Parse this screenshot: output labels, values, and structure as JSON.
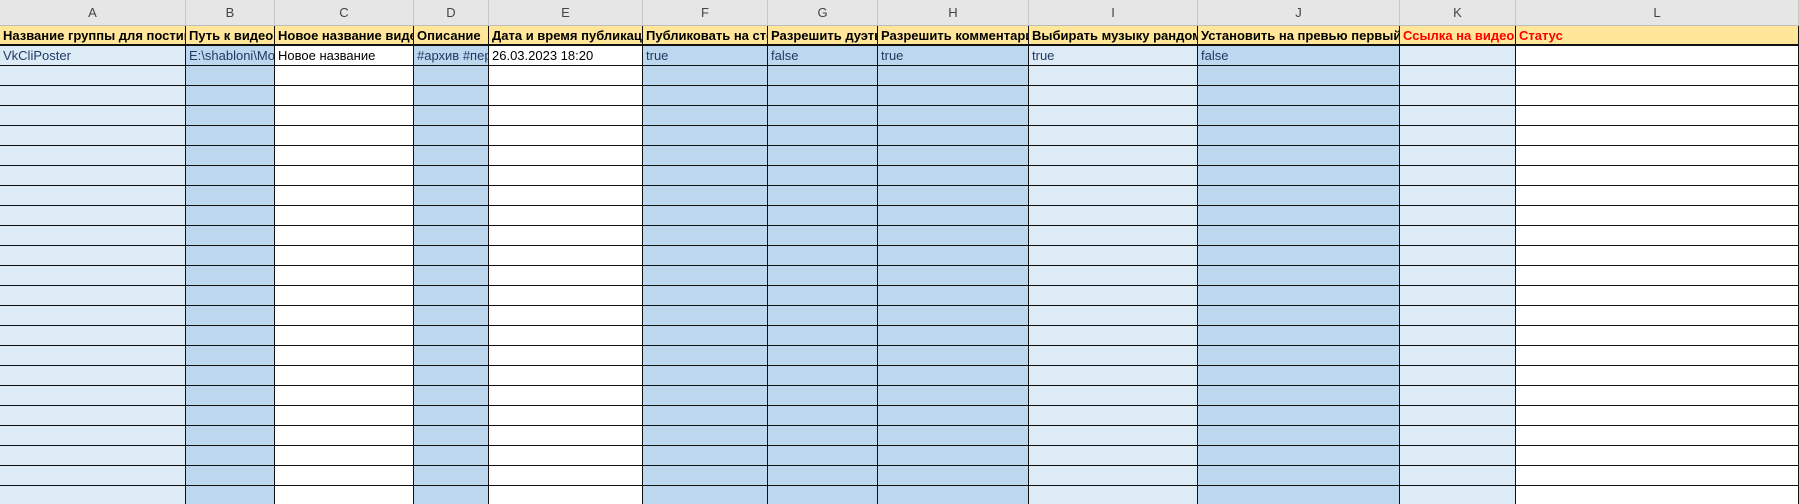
{
  "columns": [
    {
      "letter": "A",
      "header": "Название группы для постинга",
      "fill": "light"
    },
    {
      "letter": "B",
      "header": "Путь к видео",
      "fill": "mid"
    },
    {
      "letter": "C",
      "header": "Новое название видео",
      "fill": "white"
    },
    {
      "letter": "D",
      "header": "Описание",
      "fill": "mid"
    },
    {
      "letter": "E",
      "header": "Дата и время публикации",
      "fill": "white"
    },
    {
      "letter": "F",
      "header": "Публиковать на стене",
      "fill": "mid"
    },
    {
      "letter": "G",
      "header": "Разрешить дуэты",
      "fill": "mid"
    },
    {
      "letter": "H",
      "header": "Разрешить комментарии",
      "fill": "mid"
    },
    {
      "letter": "I",
      "header": "Выбирать музыку рандомно",
      "fill": "light"
    },
    {
      "letter": "J",
      "header": "Установить на превью первый кадр",
      "fill": "mid"
    },
    {
      "letter": "K",
      "header": "Ссылка на видео",
      "fill": "light"
    },
    {
      "letter": "L",
      "header": "Статус",
      "fill": "white"
    }
  ],
  "red_headers": [
    "K",
    "L"
  ],
  "colors": {
    "header_fill": "#ffe699",
    "light_blue": "#ddebf7",
    "mid_blue": "#bdd7ee",
    "value_text": "#1f3a64",
    "red": "#ff0000"
  },
  "rows": [
    [
      "VkCliPoster",
      "E:\\shabloni\\Movie",
      "Новое название",
      "#архив #перезалив",
      "26.03.2023 18:20",
      "true",
      "false",
      "true",
      "true",
      "false",
      "",
      ""
    ]
  ],
  "empty_row_count": 22
}
